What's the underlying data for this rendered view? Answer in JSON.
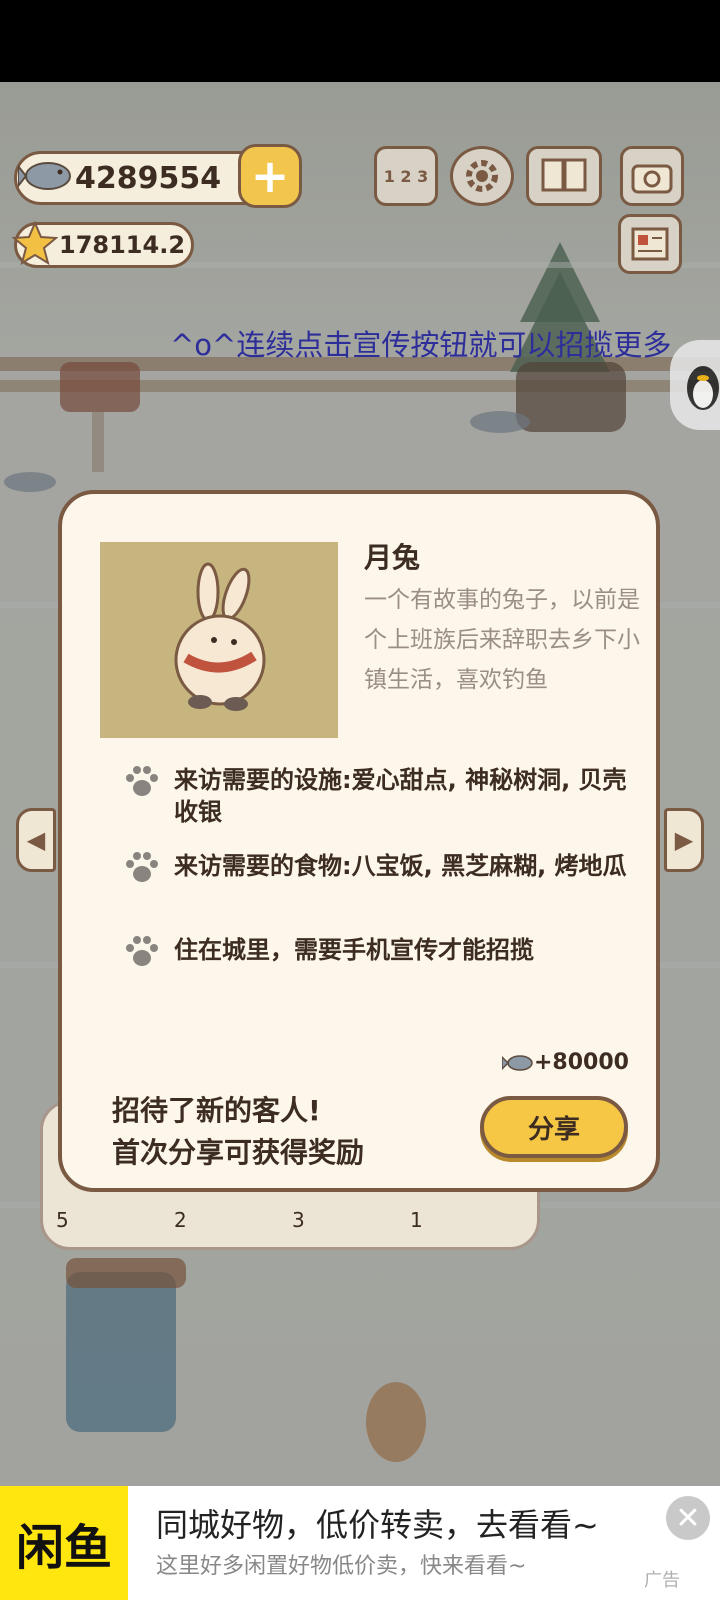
{
  "hud": {
    "fish_count": "4289554",
    "star_count": "178114.2",
    "plus_label": "+",
    "ranking_icon_text": "1 2 3"
  },
  "ticker": "^o^连续点击宣传按钮就可以招揽更多",
  "nav": {
    "left_arrow": "◀",
    "right_arrow": "▶"
  },
  "character": {
    "name": "月兔",
    "description": "一个有故事的兔子，以前是个上班族后来辞职去乡下小镇生活，喜欢钓鱼",
    "requirements": [
      "来访需要的设施:爱心甜点, 神秘树洞, 贝壳收银",
      "来访需要的食物:八宝饭, 黑芝麻糊, 烤地瓜",
      "住在城里，需要手机宣传才能招揽"
    ]
  },
  "share": {
    "reward": "+80000",
    "message_line1": "招待了新的客人!",
    "message_line2": "首次分享可获得奖励",
    "button_label": "分享"
  },
  "tray_slots": [
    "5",
    "2",
    "3",
    "1"
  ],
  "ad": {
    "logo": "闲鱼",
    "title": "同城好物，低价转卖，去看看~",
    "subtitle": "这里好多闲置好物低价卖，快来看看~",
    "tag": "广告",
    "close": "✕"
  },
  "colors": {
    "card_bg": "#fdf6ea",
    "card_border": "#7b5a44",
    "share_button": "#f6c744",
    "ticker_text": "#2e2e9a",
    "ad_logo_bg": "#ffe60f"
  }
}
